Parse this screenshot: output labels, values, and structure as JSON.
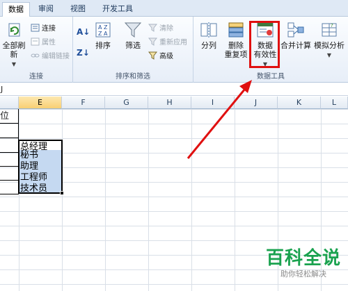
{
  "tabs": [
    {
      "label": "数据",
      "active": true
    },
    {
      "label": "审阅",
      "active": false
    },
    {
      "label": "视图",
      "active": false
    },
    {
      "label": "开发工具",
      "active": false
    }
  ],
  "groups": {
    "connections": {
      "label": "连接",
      "refresh_all": "全部刷新",
      "connections": "连接",
      "properties": "属性",
      "edit_links": "编辑链接"
    },
    "sort_filter": {
      "label": "排序和筛选",
      "sort": "排序",
      "filter": "筛选",
      "clear": "清除",
      "reapply": "重新应用",
      "advanced": "高级"
    },
    "data_tools": {
      "label": "数据工具",
      "split_column": "分列",
      "remove_duplicates_line1": "删除",
      "remove_duplicates_line2": "重复项",
      "data_validation_line1": "数据",
      "data_validation_line2": "有效性",
      "consolidate": "合并计算",
      "what_if": "模拟分析"
    }
  },
  "formula_bar": {
    "name_box": "J"
  },
  "columns": [
    "E",
    "F",
    "G",
    "H",
    "I",
    "J",
    "K",
    "L"
  ],
  "left_stub_text": "位",
  "cells": [
    "总经理",
    "秘书",
    "助理",
    "工程师",
    "技术员"
  ],
  "colors": {
    "highlight": "#e01010",
    "arrow": "#e01010",
    "selection": "#c5d9f1",
    "watermark": "#1aa24f"
  },
  "watermark": {
    "title": "百科全说",
    "subtitle": "助你轻松解决"
  }
}
